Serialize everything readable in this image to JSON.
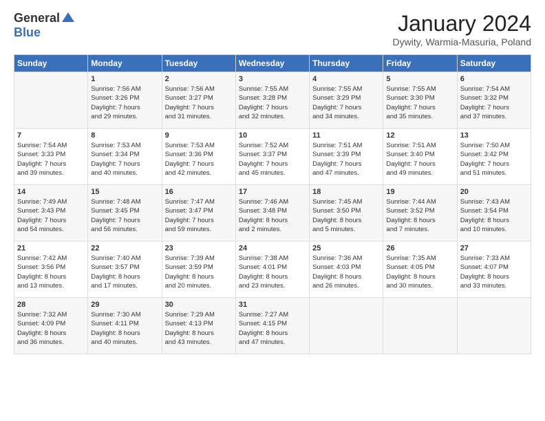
{
  "logo": {
    "general": "General",
    "blue": "Blue"
  },
  "title": "January 2024",
  "subtitle": "Dywity, Warmia-Masuria, Poland",
  "days": [
    "Sunday",
    "Monday",
    "Tuesday",
    "Wednesday",
    "Thursday",
    "Friday",
    "Saturday"
  ],
  "weeks": [
    [
      {
        "num": "",
        "lines": []
      },
      {
        "num": "1",
        "lines": [
          "Sunrise: 7:56 AM",
          "Sunset: 3:26 PM",
          "Daylight: 7 hours",
          "and 29 minutes."
        ]
      },
      {
        "num": "2",
        "lines": [
          "Sunrise: 7:56 AM",
          "Sunset: 3:27 PM",
          "Daylight: 7 hours",
          "and 31 minutes."
        ]
      },
      {
        "num": "3",
        "lines": [
          "Sunrise: 7:55 AM",
          "Sunset: 3:28 PM",
          "Daylight: 7 hours",
          "and 32 minutes."
        ]
      },
      {
        "num": "4",
        "lines": [
          "Sunrise: 7:55 AM",
          "Sunset: 3:29 PM",
          "Daylight: 7 hours",
          "and 34 minutes."
        ]
      },
      {
        "num": "5",
        "lines": [
          "Sunrise: 7:55 AM",
          "Sunset: 3:30 PM",
          "Daylight: 7 hours",
          "and 35 minutes."
        ]
      },
      {
        "num": "6",
        "lines": [
          "Sunrise: 7:54 AM",
          "Sunset: 3:32 PM",
          "Daylight: 7 hours",
          "and 37 minutes."
        ]
      }
    ],
    [
      {
        "num": "7",
        "lines": [
          "Sunrise: 7:54 AM",
          "Sunset: 3:33 PM",
          "Daylight: 7 hours",
          "and 39 minutes."
        ]
      },
      {
        "num": "8",
        "lines": [
          "Sunrise: 7:53 AM",
          "Sunset: 3:34 PM",
          "Daylight: 7 hours",
          "and 40 minutes."
        ]
      },
      {
        "num": "9",
        "lines": [
          "Sunrise: 7:53 AM",
          "Sunset: 3:36 PM",
          "Daylight: 7 hours",
          "and 42 minutes."
        ]
      },
      {
        "num": "10",
        "lines": [
          "Sunrise: 7:52 AM",
          "Sunset: 3:37 PM",
          "Daylight: 7 hours",
          "and 45 minutes."
        ]
      },
      {
        "num": "11",
        "lines": [
          "Sunrise: 7:51 AM",
          "Sunset: 3:39 PM",
          "Daylight: 7 hours",
          "and 47 minutes."
        ]
      },
      {
        "num": "12",
        "lines": [
          "Sunrise: 7:51 AM",
          "Sunset: 3:40 PM",
          "Daylight: 7 hours",
          "and 49 minutes."
        ]
      },
      {
        "num": "13",
        "lines": [
          "Sunrise: 7:50 AM",
          "Sunset: 3:42 PM",
          "Daylight: 7 hours",
          "and 51 minutes."
        ]
      }
    ],
    [
      {
        "num": "14",
        "lines": [
          "Sunrise: 7:49 AM",
          "Sunset: 3:43 PM",
          "Daylight: 7 hours",
          "and 54 minutes."
        ]
      },
      {
        "num": "15",
        "lines": [
          "Sunrise: 7:48 AM",
          "Sunset: 3:45 PM",
          "Daylight: 7 hours",
          "and 56 minutes."
        ]
      },
      {
        "num": "16",
        "lines": [
          "Sunrise: 7:47 AM",
          "Sunset: 3:47 PM",
          "Daylight: 7 hours",
          "and 59 minutes."
        ]
      },
      {
        "num": "17",
        "lines": [
          "Sunrise: 7:46 AM",
          "Sunset: 3:48 PM",
          "Daylight: 8 hours",
          "and 2 minutes."
        ]
      },
      {
        "num": "18",
        "lines": [
          "Sunrise: 7:45 AM",
          "Sunset: 3:50 PM",
          "Daylight: 8 hours",
          "and 5 minutes."
        ]
      },
      {
        "num": "19",
        "lines": [
          "Sunrise: 7:44 AM",
          "Sunset: 3:52 PM",
          "Daylight: 8 hours",
          "and 7 minutes."
        ]
      },
      {
        "num": "20",
        "lines": [
          "Sunrise: 7:43 AM",
          "Sunset: 3:54 PM",
          "Daylight: 8 hours",
          "and 10 minutes."
        ]
      }
    ],
    [
      {
        "num": "21",
        "lines": [
          "Sunrise: 7:42 AM",
          "Sunset: 3:56 PM",
          "Daylight: 8 hours",
          "and 13 minutes."
        ]
      },
      {
        "num": "22",
        "lines": [
          "Sunrise: 7:40 AM",
          "Sunset: 3:57 PM",
          "Daylight: 8 hours",
          "and 17 minutes."
        ]
      },
      {
        "num": "23",
        "lines": [
          "Sunrise: 7:39 AM",
          "Sunset: 3:59 PM",
          "Daylight: 8 hours",
          "and 20 minutes."
        ]
      },
      {
        "num": "24",
        "lines": [
          "Sunrise: 7:38 AM",
          "Sunset: 4:01 PM",
          "Daylight: 8 hours",
          "and 23 minutes."
        ]
      },
      {
        "num": "25",
        "lines": [
          "Sunrise: 7:36 AM",
          "Sunset: 4:03 PM",
          "Daylight: 8 hours",
          "and 26 minutes."
        ]
      },
      {
        "num": "26",
        "lines": [
          "Sunrise: 7:35 AM",
          "Sunset: 4:05 PM",
          "Daylight: 8 hours",
          "and 30 minutes."
        ]
      },
      {
        "num": "27",
        "lines": [
          "Sunrise: 7:33 AM",
          "Sunset: 4:07 PM",
          "Daylight: 8 hours",
          "and 33 minutes."
        ]
      }
    ],
    [
      {
        "num": "28",
        "lines": [
          "Sunrise: 7:32 AM",
          "Sunset: 4:09 PM",
          "Daylight: 8 hours",
          "and 36 minutes."
        ]
      },
      {
        "num": "29",
        "lines": [
          "Sunrise: 7:30 AM",
          "Sunset: 4:11 PM",
          "Daylight: 8 hours",
          "and 40 minutes."
        ]
      },
      {
        "num": "30",
        "lines": [
          "Sunrise: 7:29 AM",
          "Sunset: 4:13 PM",
          "Daylight: 8 hours",
          "and 43 minutes."
        ]
      },
      {
        "num": "31",
        "lines": [
          "Sunrise: 7:27 AM",
          "Sunset: 4:15 PM",
          "Daylight: 8 hours",
          "and 47 minutes."
        ]
      },
      {
        "num": "",
        "lines": []
      },
      {
        "num": "",
        "lines": []
      },
      {
        "num": "",
        "lines": []
      }
    ]
  ]
}
